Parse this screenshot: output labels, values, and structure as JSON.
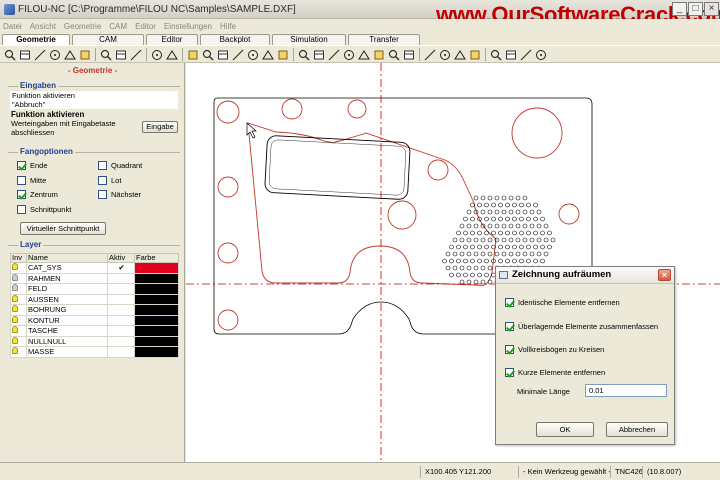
{
  "window": {
    "title": "FILOU-NC  [C:\\Programme\\FILOU NC\\Samples\\SAMPLE.DXF]",
    "watermark": "www.OurSoftwareCrack.com"
  },
  "menu": [
    "Datei",
    "Ansicht",
    "Geometrie",
    "CAM",
    "Editor",
    "Einstellungen",
    "Hilfe"
  ],
  "tabs": [
    {
      "label": "Geometrie",
      "active": true
    },
    {
      "label": "CAM",
      "active": false
    },
    {
      "label": "Editor",
      "active": false
    },
    {
      "label": "Backplot",
      "active": false
    },
    {
      "label": "Simulation",
      "active": false
    },
    {
      "label": "Transfer",
      "active": false
    }
  ],
  "toolbar_icons": [
    "zoom-in-icon",
    "zoom-out-icon",
    "zoom-window-icon",
    "zoom-all-icon",
    "tree-icon",
    "palette-icon",
    "new-file-icon",
    "open-file-icon",
    "save-icon",
    "undo-icon",
    "redo-icon",
    "circle-element-icon",
    "line-icon",
    "rectangle-icon",
    "angle-line-icon",
    "polyline-icon",
    "circle-icon",
    "circle-2p-icon",
    "arc-icon",
    "fillet-icon",
    "parallel-icon",
    "offset-icon",
    "corner-icon",
    "trim-icon",
    "extend-icon",
    "split-icon",
    "grid-icon",
    "array-icon",
    "copy-icon",
    "delete-icon",
    "measure-icon",
    "dimension-icon",
    "layer-icon",
    "help-icon"
  ],
  "panel": {
    "title": "- Geometrie -",
    "input_group": "Eingaben",
    "input_lines": [
      "Funktion aktivieren",
      "\"Abbruch\""
    ],
    "function_active": "Funktion aktivieren",
    "hint": "Werteingaben mit Eingabetaste abschliessen",
    "input_button": "Eingabe",
    "snap_group": "Fangoptionen",
    "snaps": [
      {
        "label": "Ende",
        "checked": true
      },
      {
        "label": "Quadrant",
        "checked": false
      },
      {
        "label": "Mitte",
        "checked": false
      },
      {
        "label": "Lot",
        "checked": false
      },
      {
        "label": "Zentrum",
        "checked": true
      },
      {
        "label": "Nächster",
        "checked": false
      },
      {
        "label": "Schnittpunkt",
        "checked": false
      }
    ],
    "virtual_button": "Virtueller Schnittpunkt",
    "layer_group": "Layer",
    "layer_headers": [
      "Inv",
      "Name",
      "Aktiv",
      "Farbe"
    ],
    "layers": [
      {
        "name": "CAT_SYS",
        "active": "✔",
        "on": true,
        "color": "#e0001b"
      },
      {
        "name": "RAHMEN",
        "active": "",
        "on": false,
        "color": "#000000"
      },
      {
        "name": "FELD",
        "active": "",
        "on": false,
        "color": "#000000"
      },
      {
        "name": "AUSSEN",
        "active": "",
        "on": true,
        "color": "#000000"
      },
      {
        "name": "BOHRUNG",
        "active": "",
        "on": true,
        "color": "#000000"
      },
      {
        "name": "KONTUR",
        "active": "",
        "on": true,
        "color": "#000000"
      },
      {
        "name": "TASCHE",
        "active": "",
        "on": true,
        "color": "#000000"
      },
      {
        "name": "NULLNULL",
        "active": "",
        "on": true,
        "color": "#000000"
      },
      {
        "name": "MASSE",
        "active": "",
        "on": true,
        "color": "#000000"
      }
    ]
  },
  "dialog": {
    "title": "Zeichnung aufräumen",
    "options": [
      {
        "label": "Identische Elemente entfernen",
        "checked": true
      },
      {
        "label": "Überlagernde Elemente zusammenfassen",
        "checked": true
      },
      {
        "label": "Vollkreisbögen zu Kreisen",
        "checked": true
      },
      {
        "label": "Kurze Elemente entfernen",
        "checked": true
      }
    ],
    "min_length_label": "Minimale Länge",
    "min_length_value": "0.01",
    "ok": "OK",
    "cancel": "Abbrechen"
  },
  "status": {
    "coords": "X100.405 Y121.200",
    "tool": "- Kein Werkzeug gewählt -",
    "control": "TNC426",
    "version": "(10.8.007)"
  },
  "colors": {
    "contour": "#c0392b",
    "axis": "#c00000",
    "frame": "#000000"
  }
}
